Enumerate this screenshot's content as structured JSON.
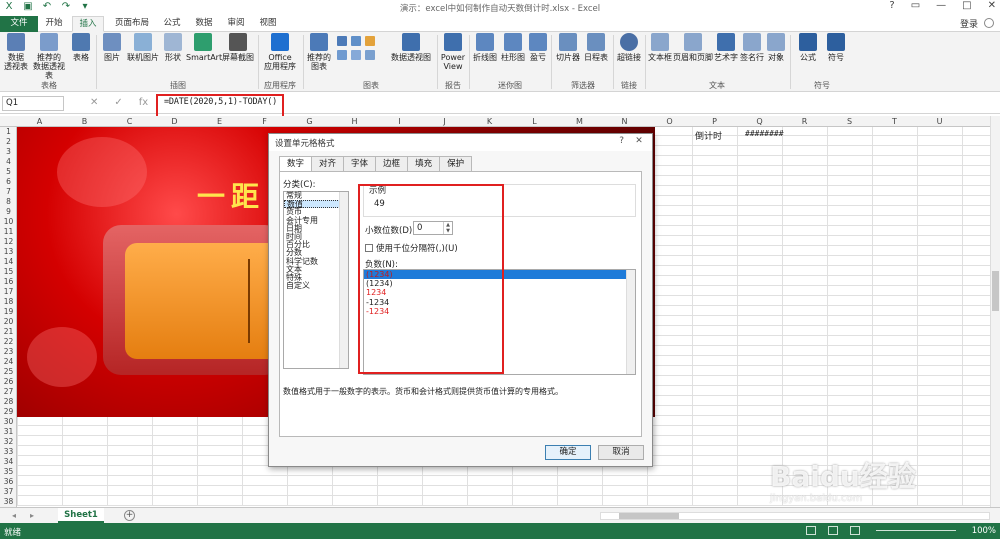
{
  "title": "演示：excel中如何制作自动天数倒计时.xlsx - Excel",
  "login": "登录",
  "tabs": [
    "文件",
    "开始",
    "插入",
    "页面布局",
    "公式",
    "数据",
    "审阅",
    "视图"
  ],
  "ribbon": {
    "buttons": [
      {
        "label": "数据\n透视表"
      },
      {
        "label": "推荐的\n数据透视表"
      },
      {
        "label": "表格"
      },
      {
        "label": "图片"
      },
      {
        "label": "联机图片"
      },
      {
        "label": "形状"
      },
      {
        "label": "SmartArt"
      },
      {
        "label": "屏幕截图"
      },
      {
        "label": "Office\n应用程序"
      },
      {
        "label": "推荐的\n图表"
      },
      {
        "label": "数据透视图"
      },
      {
        "label": "Power\nView"
      },
      {
        "label": "折线图"
      },
      {
        "label": "柱形图"
      },
      {
        "label": "盈亏"
      },
      {
        "label": "切片器"
      },
      {
        "label": "日程表"
      },
      {
        "label": "超链接"
      },
      {
        "label": "文本框"
      },
      {
        "label": "页眉和页脚"
      },
      {
        "label": "艺术字"
      },
      {
        "label": "签名行"
      },
      {
        "label": "对象"
      },
      {
        "label": "公式"
      },
      {
        "label": "符号"
      }
    ],
    "groups": [
      "表格",
      "插图",
      "应用程序",
      "图表",
      "报告",
      "迷你图",
      "筛选器",
      "链接",
      "文本",
      "符号"
    ]
  },
  "formula_bar": {
    "name_box": "Q1",
    "formula": "=DATE(2020,5,1)-TODAY()",
    "icons": [
      "✕",
      "✓",
      "fx"
    ]
  },
  "columns": [
    "A",
    "B",
    "C",
    "D",
    "E",
    "F",
    "G",
    "H",
    "I",
    "J",
    "K",
    "L",
    "M",
    "N",
    "O",
    "P",
    "Q",
    "R",
    "S",
    "T",
    "U"
  ],
  "rows": [
    "1",
    "2",
    "3",
    "4",
    "5",
    "6",
    "7",
    "8",
    "9",
    "10",
    "11",
    "12",
    "13",
    "14",
    "15",
    "16",
    "17",
    "18",
    "19",
    "20",
    "21",
    "22",
    "23",
    "24",
    "25",
    "26",
    "27",
    "28",
    "29",
    "30",
    "31",
    "32",
    "33",
    "34",
    "35",
    "36",
    "37",
    "38"
  ],
  "cells": {
    "p1": "倒计时",
    "q1": "########"
  },
  "picture": {
    "title_text": "一距"
  },
  "dialog": {
    "title": "设置单元格格式",
    "help": "?",
    "close": "✕",
    "tabs": [
      "数字",
      "对齐",
      "字体",
      "边框",
      "填充",
      "保护"
    ],
    "category_label": "分类(C):",
    "categories": [
      "常规",
      "数值",
      "货币",
      "会计专用",
      "日期",
      "时间",
      "百分比",
      "分数",
      "科学记数",
      "文本",
      "特殊",
      "自定义"
    ],
    "sample_label": "示例",
    "sample_value": "49",
    "decimal_label": "小数位数(D):",
    "decimal_value": "0",
    "thousands_label": "使用千位分隔符(,)(U)",
    "negative_label": "负数(N):",
    "negative_options": [
      "(1234)",
      "(1234)",
      "1234",
      "-1234",
      "-1234"
    ],
    "description": "数值格式用于一般数字的表示。货币和会计格式则提供货币值计算的专用格式。",
    "ok": "确定",
    "cancel": "取消"
  },
  "sheet": {
    "tab": "Sheet1",
    "add": "+",
    "nav": [
      "◂",
      "▸"
    ]
  },
  "status": {
    "text": "就绪",
    "zoom": "100%"
  },
  "watermark": {
    "main": "Baidu经验",
    "sub": "jingyan.baidu.com"
  },
  "colors": {
    "accent": "#217346",
    "highlight_box": "#e02020",
    "negative_red": "#e02020"
  }
}
